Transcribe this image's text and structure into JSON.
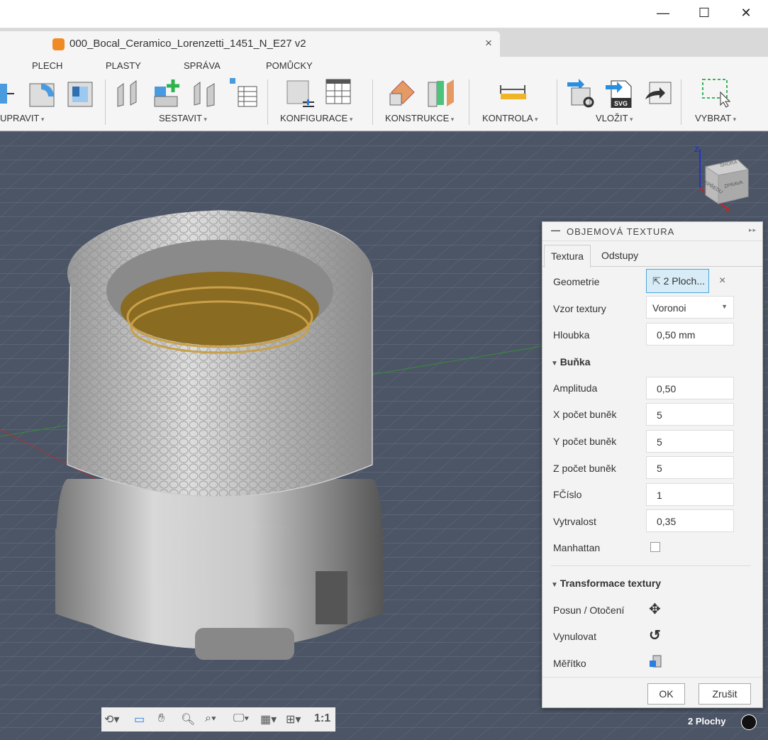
{
  "window": {
    "minimize": "—",
    "maximize": "☐",
    "close": "✕"
  },
  "document": {
    "title": "000_Bocal_Ceramico_Lorenzetti_1451_N_E27 v2",
    "close": "×",
    "new_tab": "+"
  },
  "top_icons": [
    "data-panel-icon",
    "history-icon",
    "notification-icon",
    "job-status-icon",
    "help-icon",
    "learning-icon"
  ],
  "menu": [
    "PLECH",
    "PLASTY",
    "SPRÁVA",
    "POMŮCKY"
  ],
  "groups": {
    "upravit": "UPRAVIT",
    "sestavit": "SESTAVIT",
    "konfigurace": "KONFIGURACE",
    "konstrukce": "KONSTRUKCE",
    "kontrola": "KONTROLA",
    "vlozit": "VLOŽIT",
    "vybrat": "VYBRAT"
  },
  "viewcube": {
    "top": "SHORA",
    "front": "ZEPŘEDU",
    "right": "ZPRAVA",
    "z": "Z",
    "x": "X"
  },
  "panel": {
    "title": "OBJEMOVÁ TEXTURA",
    "tabs": [
      "Textura",
      "Odstupy"
    ],
    "geometrie": {
      "label": "Geometrie",
      "value": "2 Ploch...",
      "clear": "×"
    },
    "vzor": {
      "label": "Vzor textury",
      "value": "Voronoi"
    },
    "hloubka": {
      "label": "Hloubka",
      "value": "0,50 mm"
    },
    "bunka": {
      "title": "Buňka",
      "amplituda": {
        "label": "Amplituda",
        "value": "0,50"
      },
      "x": {
        "label": "X počet buněk",
        "value": "5"
      },
      "y": {
        "label": "Y počet buněk",
        "value": "5"
      },
      "z": {
        "label": "Z počet buněk",
        "value": "5"
      },
      "fcislo": {
        "label": "FČíslo",
        "value": "1"
      },
      "vytrvalost": {
        "label": "Vytrvalost",
        "value": "0,35"
      },
      "manhattan": {
        "label": "Manhattan",
        "checked": false
      }
    },
    "transform": {
      "title": "Transformace textury",
      "posun": "Posun / Otočení",
      "vynulovat": "Vynulovat",
      "meritko": "Měřítko"
    },
    "ok": "OK",
    "cancel": "Zrušit"
  },
  "navbar": {
    "zoom_ratio": "1:1"
  },
  "status": "2 Plochy"
}
